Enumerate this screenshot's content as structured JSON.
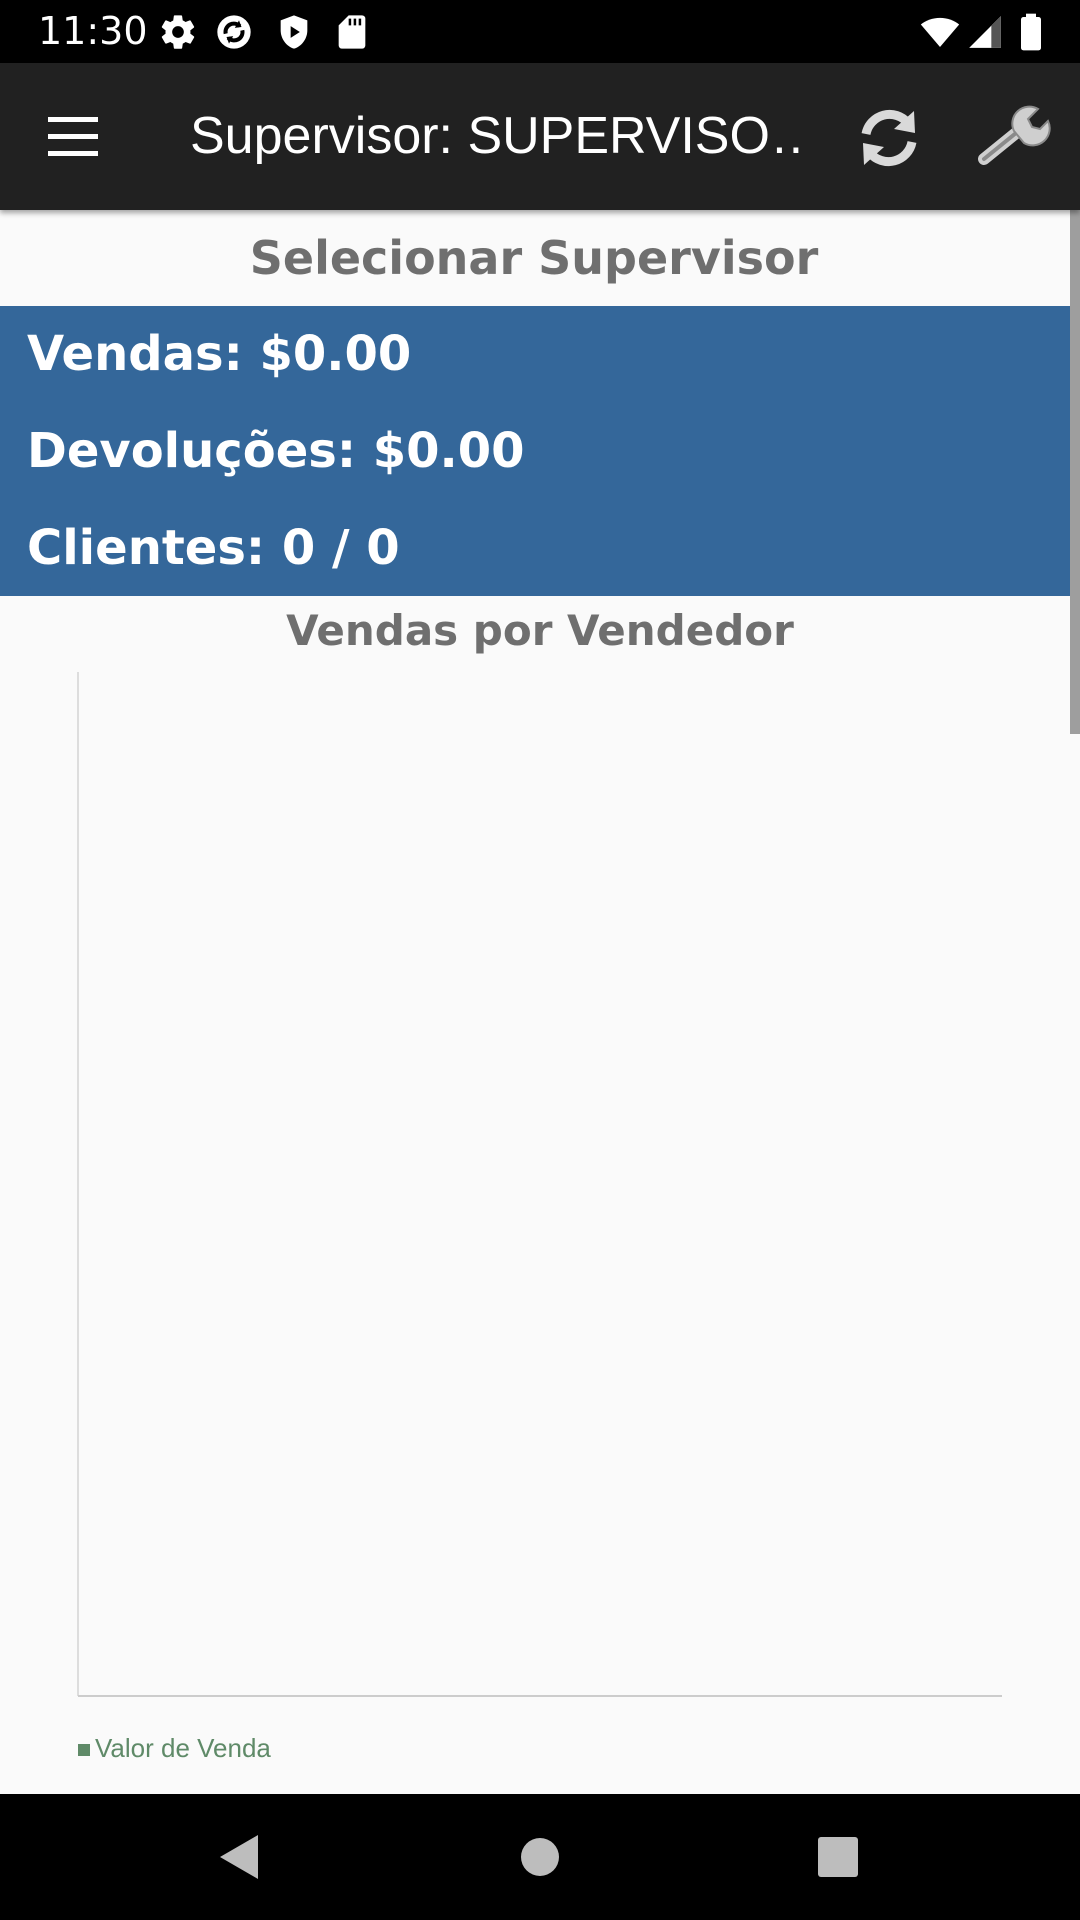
{
  "status_bar": {
    "time": "11:30",
    "icons_left": [
      "settings-icon",
      "sync-app-icon",
      "shield-play-icon",
      "sd-card-icon"
    ],
    "icons_right": [
      "wifi-icon",
      "signal-icon",
      "battery-icon"
    ]
  },
  "app_bar": {
    "title": "Supervisor: SUPERVISO…",
    "menu_icon": "hamburger-menu-icon",
    "refresh_icon": "refresh-icon",
    "settings_icon": "wrench-icon"
  },
  "select_supervisor_label": "Selecionar Supervisor",
  "summary": {
    "background": "#34679a",
    "sales": "Vendas: $0.00",
    "returns": "Devoluções: $0.00",
    "clients": "Clientes: 0 / 0"
  },
  "chart_data": {
    "type": "bar",
    "title": "Vendas por Vendedor",
    "categories": [],
    "series": [
      {
        "name": "Valor de Venda",
        "color": "#5f8a68",
        "values": []
      }
    ],
    "legend_position": "bottom-left",
    "grid": false
  },
  "nav_bar": {
    "buttons": [
      "back-icon",
      "home-icon",
      "recents-icon"
    ]
  }
}
